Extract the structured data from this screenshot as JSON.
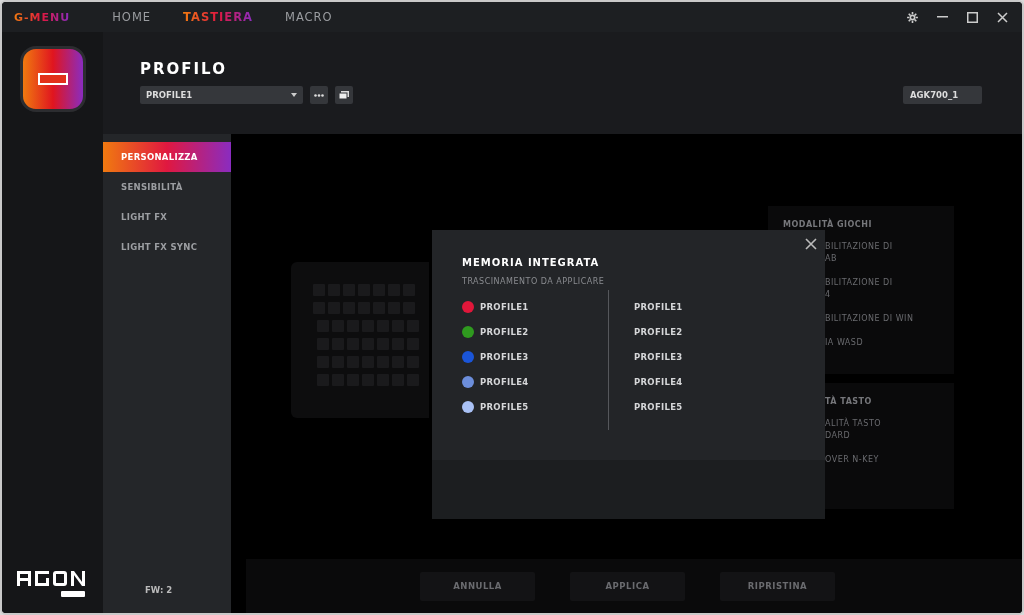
{
  "app_name": "G-MENU",
  "tabs": [
    {
      "label": "HOME",
      "selected": false
    },
    {
      "label": "TASTIERA",
      "selected": true
    },
    {
      "label": "MACRO",
      "selected": false
    }
  ],
  "header": {
    "title": "PROFILO",
    "profile_select": "PROFILE1",
    "device": "AGK700_1"
  },
  "sidebar": {
    "items": [
      {
        "label": "PERSONALIZZA",
        "selected": true
      },
      {
        "label": "SENSIBILITÀ",
        "selected": false
      },
      {
        "label": "LIGHT FX",
        "selected": false
      },
      {
        "label": "LIGHT FX SYNC",
        "selected": false
      }
    ],
    "firmware": "FW: 2"
  },
  "right_panels": [
    {
      "title": "MODALITÀ GIOCHI",
      "items": [
        [
          "BILITAZIONE DI",
          "AB"
        ],
        [
          "BILITAZIONE DI",
          "4"
        ],
        [
          "BILITAZIONE DI WIN"
        ],
        [
          "IA WASD"
        ]
      ]
    },
    {
      "title": "TÀ TASTO",
      "items": [
        [
          "ALITÀ TASTO",
          "DARD"
        ],
        [
          "OVER N-KEY"
        ]
      ]
    }
  ],
  "footer_buttons": [
    "ANNULLA",
    "APPLICA",
    "RIPRISTINA"
  ],
  "dialog": {
    "title": "MEMORIA INTEGRATA",
    "subtitle": "TRASCINAMENTO DA APPLICARE",
    "left_profiles": [
      {
        "label": "PROFILE1",
        "color": "#e0173a"
      },
      {
        "label": "PROFILE2",
        "color": "#2f9a1f"
      },
      {
        "label": "PROFILE3",
        "color": "#1a55d8"
      },
      {
        "label": "PROFILE4",
        "color": "#6c8edb"
      },
      {
        "label": "PROFILE5",
        "color": "#a9c1f5"
      }
    ],
    "right_profiles": [
      "PROFILE1",
      "PROFILE2",
      "PROFILE3",
      "PROFILE4",
      "PROFILE5"
    ]
  }
}
